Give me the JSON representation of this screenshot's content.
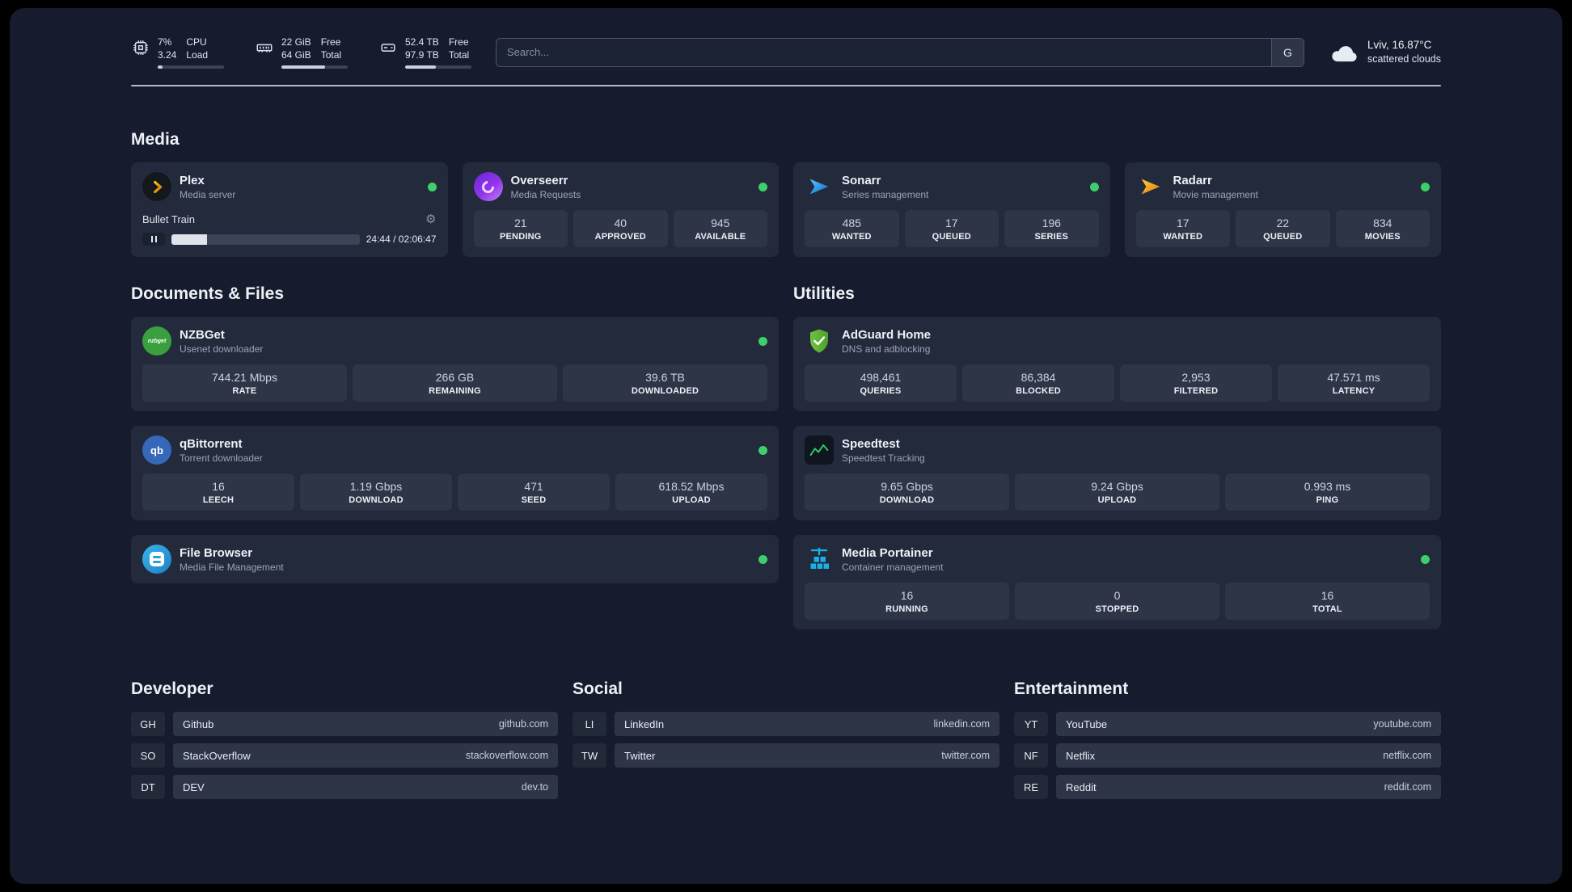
{
  "colors": {
    "page_bg": "#161c2d",
    "card_bg": "#232a3c",
    "tile_bg": "#2d3547",
    "status_online": "#3ecf6a",
    "divider": "#d2d7e0"
  },
  "topbar": {
    "cpu": {
      "icon": "cpu-icon",
      "value_top": "7%",
      "value_bottom": "3.24",
      "label_top": "CPU",
      "label_bottom": "Load",
      "percent": 7
    },
    "memory": {
      "icon": "memory-icon",
      "value_top": "22 GiB",
      "value_bottom": "64 GiB",
      "label_top": "Free",
      "label_bottom": "Total",
      "percent": 66
    },
    "storage": {
      "icon": "storage-icon",
      "value_top": "52.4 TB",
      "value_bottom": "97.9 TB",
      "label_top": "Free",
      "label_bottom": "Total",
      "percent": 46
    },
    "search": {
      "placeholder": "Search...",
      "engine_label": "G"
    },
    "weather": {
      "icon": "cloud-icon",
      "location": "Lviv, 16.87°C",
      "condition": "scattered clouds"
    }
  },
  "media": {
    "title": "Media",
    "plex": {
      "name": "Plex",
      "subtitle": "Media server",
      "now_playing": "Bullet Train",
      "time": "24:44 / 02:06:47",
      "progress_percent": 19
    },
    "overseerr": {
      "name": "Overseerr",
      "subtitle": "Media Requests",
      "stats": [
        {
          "value": "21",
          "label": "PENDING"
        },
        {
          "value": "40",
          "label": "APPROVED"
        },
        {
          "value": "945",
          "label": "AVAILABLE"
        }
      ]
    },
    "sonarr": {
      "name": "Sonarr",
      "subtitle": "Series management",
      "stats": [
        {
          "value": "485",
          "label": "WANTED"
        },
        {
          "value": "17",
          "label": "QUEUED"
        },
        {
          "value": "196",
          "label": "SERIES"
        }
      ]
    },
    "radarr": {
      "name": "Radarr",
      "subtitle": "Movie management",
      "stats": [
        {
          "value": "17",
          "label": "WANTED"
        },
        {
          "value": "22",
          "label": "QUEUED"
        },
        {
          "value": "834",
          "label": "MOVIES"
        }
      ]
    }
  },
  "documents": {
    "title": "Documents & Files",
    "nzbget": {
      "name": "NZBGet",
      "subtitle": "Usenet downloader",
      "icon_text": "nzbget",
      "stats": [
        {
          "value": "744.21 Mbps",
          "label": "RATE"
        },
        {
          "value": "266 GB",
          "label": "REMAINING"
        },
        {
          "value": "39.6 TB",
          "label": "DOWNLOADED"
        }
      ]
    },
    "qbittorrent": {
      "name": "qBittorrent",
      "subtitle": "Torrent downloader",
      "icon_text": "qb",
      "stats": [
        {
          "value": "16",
          "label": "LEECH"
        },
        {
          "value": "1.19 Gbps",
          "label": "DOWNLOAD"
        },
        {
          "value": "471",
          "label": "SEED"
        },
        {
          "value": "618.52 Mbps",
          "label": "UPLOAD"
        }
      ]
    },
    "filebrowser": {
      "name": "File Browser",
      "subtitle": "Media File Management"
    }
  },
  "utilities": {
    "title": "Utilities",
    "adguard": {
      "name": "AdGuard Home",
      "subtitle": "DNS and adblocking",
      "stats": [
        {
          "value": "498,461",
          "label": "QUERIES"
        },
        {
          "value": "86,384",
          "label": "BLOCKED"
        },
        {
          "value": "2,953",
          "label": "FILTERED"
        },
        {
          "value": "47.571 ms",
          "label": "LATENCY"
        }
      ]
    },
    "speedtest": {
      "name": "Speedtest",
      "subtitle": "Speedtest Tracking",
      "stats": [
        {
          "value": "9.65 Gbps",
          "label": "DOWNLOAD"
        },
        {
          "value": "9.24 Gbps",
          "label": "UPLOAD"
        },
        {
          "value": "0.993 ms",
          "label": "PING"
        }
      ]
    },
    "portainer": {
      "name": "Media Portainer",
      "subtitle": "Container management",
      "stats": [
        {
          "value": "16",
          "label": "RUNNING"
        },
        {
          "value": "0",
          "label": "STOPPED"
        },
        {
          "value": "16",
          "label": "TOTAL"
        }
      ]
    }
  },
  "bookmarks": [
    {
      "title": "Developer",
      "items": [
        {
          "abbr": "GH",
          "name": "Github",
          "url": "github.com"
        },
        {
          "abbr": "SO",
          "name": "StackOverflow",
          "url": "stackoverflow.com"
        },
        {
          "abbr": "DT",
          "name": "DEV",
          "url": "dev.to"
        }
      ]
    },
    {
      "title": "Social",
      "items": [
        {
          "abbr": "LI",
          "name": "LinkedIn",
          "url": "linkedin.com"
        },
        {
          "abbr": "TW",
          "name": "Twitter",
          "url": "twitter.com"
        }
      ]
    },
    {
      "title": "Entertainment",
      "items": [
        {
          "abbr": "YT",
          "name": "YouTube",
          "url": "youtube.com"
        },
        {
          "abbr": "NF",
          "name": "Netflix",
          "url": "netflix.com"
        },
        {
          "abbr": "RE",
          "name": "Reddit",
          "url": "reddit.com"
        }
      ]
    }
  ]
}
